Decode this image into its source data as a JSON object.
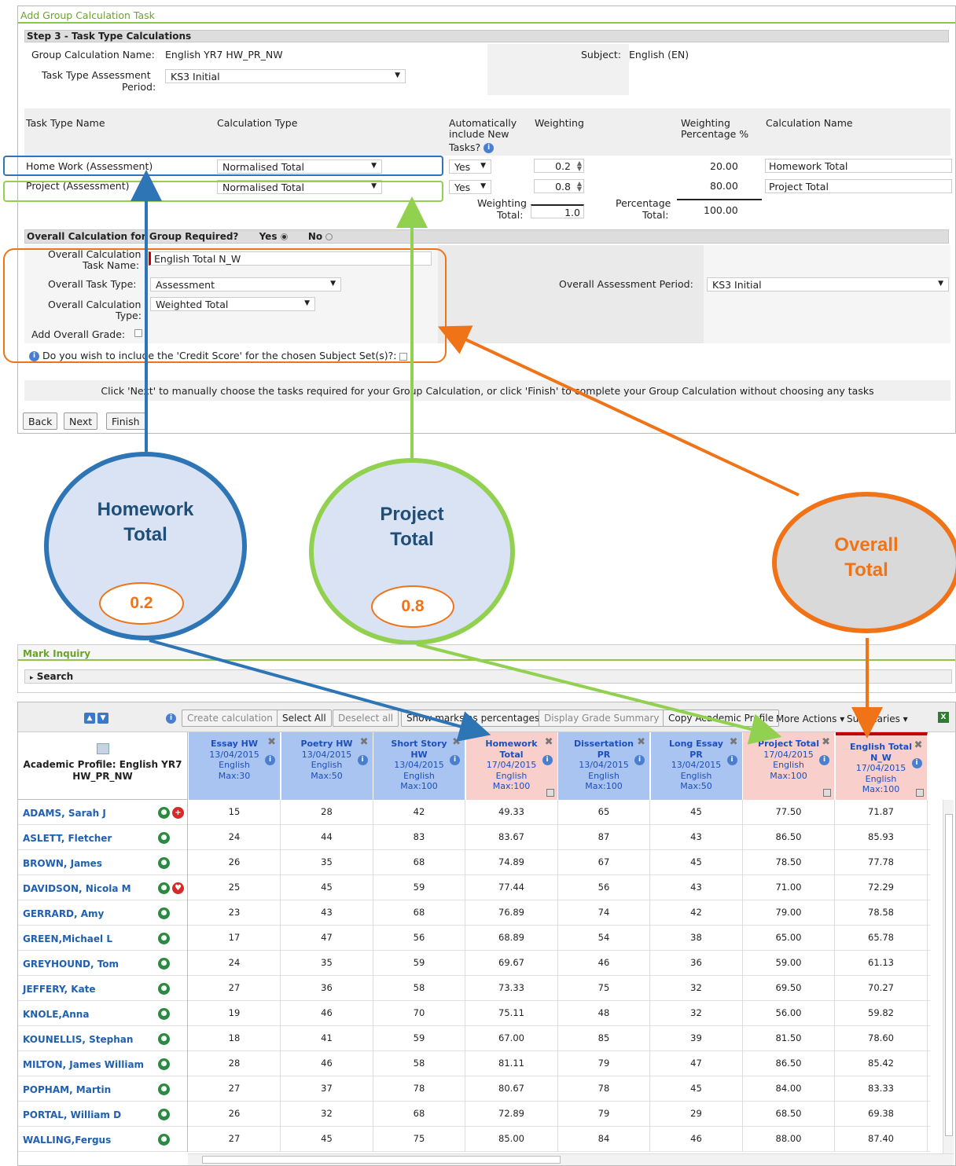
{
  "form": {
    "title": "Add Group Calculation Task",
    "step": "Step 3 - Task Type Calculations",
    "group_name_label": "Group Calculation Name:",
    "group_name": "English YR7 HW_PR_NW",
    "subject_label": "Subject:",
    "subject": "English (EN)",
    "period_label_1": "Task Type Assessment",
    "period_label_2": "Period:",
    "period_value": "KS3 Initial",
    "headers": {
      "task_type_name": "Task Type Name",
      "calc_type": "Calculation Type",
      "auto_1": "Automatically",
      "auto_2": "include New",
      "auto_3": "Tasks?",
      "weighting": "Weighting",
      "weighting_pct_1": "Weighting",
      "weighting_pct_2": "Percentage %",
      "calc_name": "Calculation Name"
    },
    "rows": [
      {
        "name": "Home Work (Assessment)",
        "calc_type": "Normalised Total",
        "auto": "Yes",
        "weight": "0.2",
        "pct": "20.00",
        "calc_name": "Homework Total"
      },
      {
        "name": "Project (Assessment)",
        "calc_type": "Normalised Total",
        "auto": "Yes",
        "weight": "0.8",
        "pct": "80.00",
        "calc_name": "Project Total"
      }
    ],
    "weighting_total_label_1": "Weighting",
    "weighting_total_label_2": "Total:",
    "weighting_total": "1.0",
    "percentage_total_label_1": "Percentage",
    "percentage_total_label_2": "Total:",
    "percentage_total": "100.00",
    "overall_bar": "Overall Calculation for Group Required?",
    "yes": "Yes",
    "no": "No",
    "overall_name_label_1": "Overall Calculation",
    "overall_name_label_2": "Task Name:",
    "overall_name": "English Total N_W",
    "overall_type_label": "Overall Task Type:",
    "overall_type": "Assessment",
    "overall_period_label": "Overall Assessment Period:",
    "overall_period": "KS3 Initial",
    "overall_calc_label_1": "Overall Calculation",
    "overall_calc_label_2": "Type:",
    "overall_calc": "Weighted Total",
    "add_grade_label": "Add Overall Grade:",
    "credit_label": "Do you wish to include the 'Credit Score' for the chosen Subject Set(s)?:",
    "hint": "Click 'Next' to manually choose the tasks required for your Group Calculation, or click 'Finish' to complete your Group Calculation without choosing any tasks",
    "buttons": {
      "back": "Back",
      "next": "Next",
      "finish": "Finish"
    }
  },
  "annotations": {
    "homework_1": "Homework",
    "homework_2": "Total",
    "homework_weight": "0.2",
    "project_1": "Project",
    "project_2": "Total",
    "project_weight": "0.8",
    "overall_1": "Overall",
    "overall_2": "Total"
  },
  "mark_inquiry": {
    "title": "Mark Inquiry",
    "search": "Search"
  },
  "grid": {
    "toolbar": {
      "create": "Create calculation",
      "select_all": "Select All",
      "deselect_all": "Deselect all",
      "show_pct": "Show marks as percentages",
      "grade_summary": "Display Grade Summary",
      "copy_profile": "Copy Academic Profile",
      "more_actions": "More Actions ▾",
      "summaries": "Summaries ▾"
    },
    "profile_1": "Academic Profile: English YR7",
    "profile_2": "HW_PR_NW",
    "columns": [
      {
        "l1": "Essay HW",
        "l2": "13/04/2015",
        "l3": "English",
        "l4": "Max:30",
        "l5": ""
      },
      {
        "l1": "Poetry HW",
        "l2": "13/04/2015",
        "l3": "English",
        "l4": "Max:50",
        "l5": ""
      },
      {
        "l1": "Short Story",
        "l2": "HW",
        "l3": "13/04/2015",
        "l4": "English",
        "l5": "Max:100"
      },
      {
        "l1": "Homework",
        "l2": "Total",
        "l3": "17/04/2015",
        "l4": "English",
        "l5": "Max:100"
      },
      {
        "l1": "Dissertation",
        "l2": "PR",
        "l3": "13/04/2015",
        "l4": "English",
        "l5": "Max:100"
      },
      {
        "l1": "Long Essay",
        "l2": "PR",
        "l3": "13/04/2015",
        "l4": "English",
        "l5": "Max:50"
      },
      {
        "l1": "Project Total",
        "l2": "17/04/2015",
        "l3": "English",
        "l4": "Max:100",
        "l5": ""
      },
      {
        "l1": "English Total",
        "l2": "N_W",
        "l3": "17/04/2015",
        "l4": "English",
        "l5": "Max:100"
      }
    ],
    "students": [
      {
        "name": "ADAMS, Sarah J",
        "marks": [
          "15",
          "28",
          "42",
          "49.33",
          "65",
          "45",
          "77.50",
          "71.87"
        ]
      },
      {
        "name": "ASLETT, Fletcher",
        "marks": [
          "24",
          "44",
          "83",
          "83.67",
          "87",
          "43",
          "86.50",
          "85.93"
        ]
      },
      {
        "name": "BROWN, James",
        "marks": [
          "26",
          "35",
          "68",
          "74.89",
          "67",
          "45",
          "78.50",
          "77.78"
        ]
      },
      {
        "name": "DAVIDSON, Nicola M",
        "marks": [
          "25",
          "45",
          "59",
          "77.44",
          "56",
          "43",
          "71.00",
          "72.29"
        ]
      },
      {
        "name": "GERRARD, Amy",
        "marks": [
          "23",
          "43",
          "68",
          "76.89",
          "74",
          "42",
          "79.00",
          "78.58"
        ]
      },
      {
        "name": "GREEN,Michael L",
        "marks": [
          "17",
          "47",
          "56",
          "68.89",
          "54",
          "38",
          "65.00",
          "65.78"
        ]
      },
      {
        "name": "GREYHOUND, Tom",
        "marks": [
          "24",
          "35",
          "59",
          "69.67",
          "46",
          "36",
          "59.00",
          "61.13"
        ]
      },
      {
        "name": "JEFFERY, Kate",
        "marks": [
          "27",
          "36",
          "58",
          "73.33",
          "75",
          "32",
          "69.50",
          "70.27"
        ]
      },
      {
        "name": "KNOLE,Anna",
        "marks": [
          "19",
          "46",
          "70",
          "75.11",
          "48",
          "32",
          "56.00",
          "59.82"
        ]
      },
      {
        "name": "KOUNELLIS, Stephan",
        "marks": [
          "18",
          "41",
          "59",
          "67.00",
          "85",
          "39",
          "81.50",
          "78.60"
        ]
      },
      {
        "name": "MILTON, James William",
        "marks": [
          "28",
          "46",
          "58",
          "81.11",
          "79",
          "47",
          "86.50",
          "85.42"
        ]
      },
      {
        "name": "POPHAM, Martin",
        "marks": [
          "27",
          "37",
          "78",
          "80.67",
          "78",
          "45",
          "84.00",
          "83.33"
        ]
      },
      {
        "name": "PORTAL, William D",
        "marks": [
          "26",
          "32",
          "68",
          "72.89",
          "79",
          "29",
          "68.50",
          "69.38"
        ]
      },
      {
        "name": "WALLING,Fergus",
        "marks": [
          "27",
          "45",
          "75",
          "85.00",
          "84",
          "46",
          "88.00",
          "87.40"
        ]
      }
    ]
  }
}
